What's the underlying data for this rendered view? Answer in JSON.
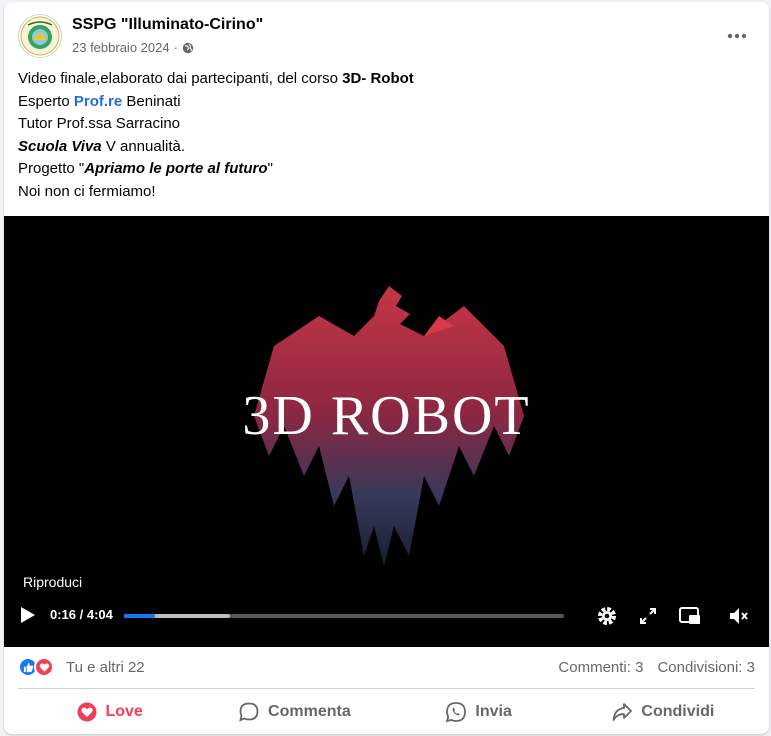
{
  "post": {
    "page_name": "SSPG \"Illuminato-Cirino\"",
    "date": "23 febbraio 2024",
    "audience_icon": "globe-icon",
    "more_icon": "ellipsis-icon",
    "text": {
      "line1_prefix": "Video finale,elaborato dai partecipanti, del corso ",
      "line1_bold": "3D- Robot",
      "line2_prefix": "Esperto ",
      "line2_link": "Prof.re",
      "line2_suffix": " Beninati",
      "line3": "Tutor Prof.ssa Sarracino",
      "line4_bold": "Scuola Viva",
      "line4_suffix": " V annualità.",
      "line5_prefix": "Progetto \"",
      "line5_bold": "Apriamo le porte al futuro",
      "line5_suffix": "\"",
      "line6": "Noi non ci fermiamo!"
    }
  },
  "video": {
    "title": "3D ROBOT",
    "play_label": "Riproduci",
    "time": "0:16 / 4:04",
    "progress_played": 0.07,
    "progress_buffered": 0.24,
    "icons": [
      "play-icon",
      "settings-icon",
      "fullscreen-icon",
      "picture-in-picture-icon",
      "mute-icon"
    ]
  },
  "engagement": {
    "reactions_text": "Tu e altri 22",
    "comments": "Commenti: 3",
    "shares": "Condivisioni: 3",
    "reaction_icons": [
      "like-icon",
      "love-icon"
    ]
  },
  "actions": {
    "love": "Love",
    "comment": "Commenta",
    "send": "Invia",
    "share": "Condividi"
  },
  "colors": {
    "link": "#216fdb",
    "love": "#f33e58",
    "like": "#1877f2",
    "progress": "#1877f2"
  }
}
